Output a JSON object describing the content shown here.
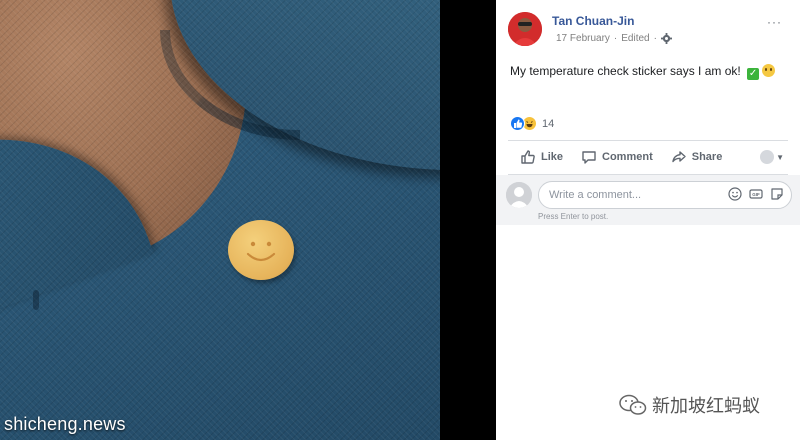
{
  "post": {
    "author": "Tan Chuan-Jin",
    "date": "17 February",
    "edited": "Edited",
    "separator": "·",
    "more": "···",
    "text": "My temperature check sticker says I am ok!",
    "reaction_count": "14"
  },
  "actions": {
    "like": "Like",
    "comment": "Comment",
    "share": "Share"
  },
  "comment": {
    "placeholder": "Write a comment...",
    "hint": "Press Enter to post."
  },
  "watermarks": {
    "left": "shicheng.news",
    "right": "新加坡红蚂蚁"
  },
  "colors": {
    "author_link": "#385898",
    "like_blue": "#1877f2",
    "shirt_blue": "#2a5675"
  }
}
